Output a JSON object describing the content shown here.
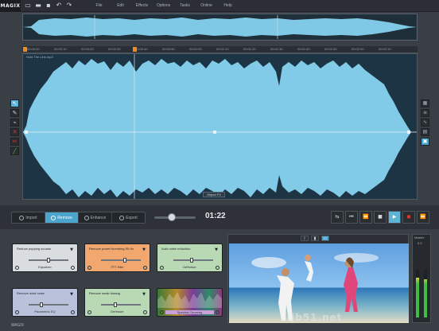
{
  "app": {
    "brand": "MAGIX"
  },
  "menu": [
    "File",
    "Edit",
    "Effects",
    "Options",
    "Tasks",
    "Online",
    "Help"
  ],
  "ruler": {
    "labels": [
      "00:00:00",
      "00:00:10",
      "00:00:20",
      "00:00:30",
      "00:00:40",
      "00:00:50",
      "00:01:00",
      "00:01:10",
      "00:01:20",
      "00:01:30",
      "00:01:40",
      "00:01:50",
      "00:02:00",
      "00:02:10",
      "00:02:20"
    ]
  },
  "wave": {
    "title": "Hold The Line.mp3",
    "zoom_label": "Object FX"
  },
  "tabs": [
    {
      "label": "Import",
      "active": false
    },
    {
      "label": "Remove",
      "active": true
    },
    {
      "label": "Enhance",
      "active": false
    },
    {
      "label": "Export",
      "active": false
    }
  ],
  "transport": {
    "time": "01:22",
    "slider_value": 0.4
  },
  "effects": [
    {
      "label": "Reduce popping sounds",
      "name": "Equalizer",
      "color": "#d9dde0",
      "level": 0.5
    },
    {
      "label": "Remove power humming 50 Hz",
      "name": "FFT filter",
      "color": "#f2a76e",
      "level": 0.6
    },
    {
      "label": "Auto noise reduction",
      "name": "DeNoiser",
      "color": "#b9d8b4",
      "level": 0.45
    },
    {
      "label": "Remove wind noise",
      "name": "Parametric EQ",
      "color": "#b9c2da",
      "level": 0.3
    },
    {
      "label": "Remove weak hissing",
      "name": "DeHisser",
      "color": "#b9d8b4",
      "level": 0.35
    },
    {
      "label": "",
      "name": "Spectral Cleaning",
      "color": "#c7a1d8",
      "level": 0
    }
  ],
  "meter": {
    "title": "Master",
    "value": "0.0"
  },
  "footer": {
    "text": "MAGIX"
  },
  "watermark": {
    "text": "jb51.net"
  }
}
